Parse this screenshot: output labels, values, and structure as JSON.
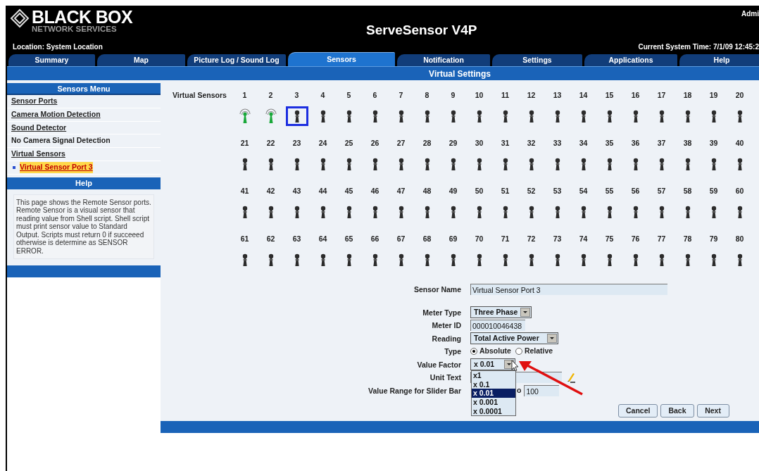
{
  "header": {
    "brand": "BLACK BOX",
    "brand_sub": "NETWORK SERVICES",
    "title": "ServeSensor V4P",
    "user": "Admi",
    "location": "Location: System Location",
    "time": "Current System Time: 7/1/09 12:45:2"
  },
  "tabs": [
    {
      "label": "Summary",
      "selected": false
    },
    {
      "label": "Map",
      "selected": false
    },
    {
      "label": "Picture Log / Sound Log",
      "selected": false
    },
    {
      "label": "Sensors",
      "selected": true
    },
    {
      "label": "Notification",
      "selected": false
    },
    {
      "label": "Settings",
      "selected": false
    },
    {
      "label": "Applications",
      "selected": false
    },
    {
      "label": "Help",
      "selected": false
    }
  ],
  "section_title": "Virtual Settings",
  "sidebar": {
    "menu_title": "Sensors Menu",
    "items": [
      {
        "label": "Sensor Ports",
        "selected": false,
        "kind": "link"
      },
      {
        "label": "Camera Motion Detection",
        "selected": false,
        "kind": "link"
      },
      {
        "label": "Sound Detector",
        "selected": false,
        "kind": "link"
      },
      {
        "label": "No Camera Signal Detection",
        "selected": false,
        "kind": "plain"
      },
      {
        "label": "Virtual Sensors",
        "selected": false,
        "kind": "link"
      },
      {
        "label": "Virtual Sensor Port 3",
        "selected": true,
        "kind": "sub"
      }
    ],
    "help_title": "Help",
    "help_text": "This page shows the Remote Sensor ports. Remote Sensor is a visual sensor that reading value from Shell script. Shell script must print sensor value to Standard Output. Scripts must return 0 if succeeed otherwise is determine as SENSOR ERROR."
  },
  "sensors": {
    "label": "Virtual Sensors",
    "items": [
      {
        "number": "1",
        "active": true,
        "selected": false
      },
      {
        "number": "2",
        "active": true,
        "selected": false
      },
      {
        "number": "3",
        "active": false,
        "selected": true
      },
      {
        "number": "4",
        "active": false,
        "selected": false
      },
      {
        "number": "5",
        "active": false,
        "selected": false
      },
      {
        "number": "6",
        "active": false,
        "selected": false
      },
      {
        "number": "7",
        "active": false,
        "selected": false
      },
      {
        "number": "8",
        "active": false,
        "selected": false
      },
      {
        "number": "9",
        "active": false,
        "selected": false
      },
      {
        "number": "10",
        "active": false,
        "selected": false
      },
      {
        "number": "11",
        "active": false,
        "selected": false
      },
      {
        "number": "12",
        "active": false,
        "selected": false
      },
      {
        "number": "13",
        "active": false,
        "selected": false
      },
      {
        "number": "14",
        "active": false,
        "selected": false
      },
      {
        "number": "15",
        "active": false,
        "selected": false
      },
      {
        "number": "16",
        "active": false,
        "selected": false
      },
      {
        "number": "17",
        "active": false,
        "selected": false
      },
      {
        "number": "18",
        "active": false,
        "selected": false
      },
      {
        "number": "19",
        "active": false,
        "selected": false
      },
      {
        "number": "20",
        "active": false,
        "selected": false
      },
      {
        "number": "21",
        "active": false,
        "selected": false
      },
      {
        "number": "22",
        "active": false,
        "selected": false
      },
      {
        "number": "23",
        "active": false,
        "selected": false
      },
      {
        "number": "24",
        "active": false,
        "selected": false
      },
      {
        "number": "25",
        "active": false,
        "selected": false
      },
      {
        "number": "26",
        "active": false,
        "selected": false
      },
      {
        "number": "27",
        "active": false,
        "selected": false
      },
      {
        "number": "28",
        "active": false,
        "selected": false
      },
      {
        "number": "29",
        "active": false,
        "selected": false
      },
      {
        "number": "30",
        "active": false,
        "selected": false
      },
      {
        "number": "31",
        "active": false,
        "selected": false
      },
      {
        "number": "32",
        "active": false,
        "selected": false
      },
      {
        "number": "33",
        "active": false,
        "selected": false
      },
      {
        "number": "34",
        "active": false,
        "selected": false
      },
      {
        "number": "35",
        "active": false,
        "selected": false
      },
      {
        "number": "36",
        "active": false,
        "selected": false
      },
      {
        "number": "37",
        "active": false,
        "selected": false
      },
      {
        "number": "38",
        "active": false,
        "selected": false
      },
      {
        "number": "39",
        "active": false,
        "selected": false
      },
      {
        "number": "40",
        "active": false,
        "selected": false
      },
      {
        "number": "41",
        "active": false,
        "selected": false
      },
      {
        "number": "42",
        "active": false,
        "selected": false
      },
      {
        "number": "43",
        "active": false,
        "selected": false
      },
      {
        "number": "44",
        "active": false,
        "selected": false
      },
      {
        "number": "45",
        "active": false,
        "selected": false
      },
      {
        "number": "46",
        "active": false,
        "selected": false
      },
      {
        "number": "47",
        "active": false,
        "selected": false
      },
      {
        "number": "48",
        "active": false,
        "selected": false
      },
      {
        "number": "49",
        "active": false,
        "selected": false
      },
      {
        "number": "50",
        "active": false,
        "selected": false
      },
      {
        "number": "51",
        "active": false,
        "selected": false
      },
      {
        "number": "52",
        "active": false,
        "selected": false
      },
      {
        "number": "53",
        "active": false,
        "selected": false
      },
      {
        "number": "54",
        "active": false,
        "selected": false
      },
      {
        "number": "55",
        "active": false,
        "selected": false
      },
      {
        "number": "56",
        "active": false,
        "selected": false
      },
      {
        "number": "57",
        "active": false,
        "selected": false
      },
      {
        "number": "58",
        "active": false,
        "selected": false
      },
      {
        "number": "59",
        "active": false,
        "selected": false
      },
      {
        "number": "60",
        "active": false,
        "selected": false
      },
      {
        "number": "61",
        "active": false,
        "selected": false
      },
      {
        "number": "62",
        "active": false,
        "selected": false
      },
      {
        "number": "63",
        "active": false,
        "selected": false
      },
      {
        "number": "64",
        "active": false,
        "selected": false
      },
      {
        "number": "65",
        "active": false,
        "selected": false
      },
      {
        "number": "66",
        "active": false,
        "selected": false
      },
      {
        "number": "67",
        "active": false,
        "selected": false
      },
      {
        "number": "68",
        "active": false,
        "selected": false
      },
      {
        "number": "69",
        "active": false,
        "selected": false
      },
      {
        "number": "70",
        "active": false,
        "selected": false
      },
      {
        "number": "71",
        "active": false,
        "selected": false
      },
      {
        "number": "72",
        "active": false,
        "selected": false
      },
      {
        "number": "73",
        "active": false,
        "selected": false
      },
      {
        "number": "74",
        "active": false,
        "selected": false
      },
      {
        "number": "75",
        "active": false,
        "selected": false
      },
      {
        "number": "76",
        "active": false,
        "selected": false
      },
      {
        "number": "77",
        "active": false,
        "selected": false
      },
      {
        "number": "78",
        "active": false,
        "selected": false
      },
      {
        "number": "79",
        "active": false,
        "selected": false
      },
      {
        "number": "80",
        "active": false,
        "selected": false
      }
    ]
  },
  "form": {
    "sensor_name": {
      "label": "Sensor Name",
      "value": "Virtual Sensor Port 3"
    },
    "meter_type": {
      "label": "Meter Type",
      "value": "Three Phase"
    },
    "meter_id": {
      "label": "Meter ID",
      "value": "000010046438"
    },
    "reading": {
      "label": "Reading",
      "value": "Total Active Power"
    },
    "type": {
      "label": "Type",
      "options": [
        {
          "label": "Absolute",
          "selected": true
        },
        {
          "label": "Relative",
          "selected": false
        }
      ]
    },
    "value_factor": {
      "label": "Value Factor",
      "value": "x 0.01",
      "expanded": true,
      "options": [
        {
          "label": "x1",
          "selected": false
        },
        {
          "label": "x 0.1",
          "selected": false
        },
        {
          "label": "x 0.01",
          "selected": true
        },
        {
          "label": "x 0.001",
          "selected": false
        },
        {
          "label": "x 0.0001",
          "selected": false
        }
      ]
    },
    "unit_text": {
      "label": "Unit Text"
    },
    "value_range": {
      "label": "Value Range for Slider Bar",
      "separator": "o",
      "to": "100"
    }
  },
  "buttons": [
    "Cancel",
    "Back",
    "Next"
  ]
}
